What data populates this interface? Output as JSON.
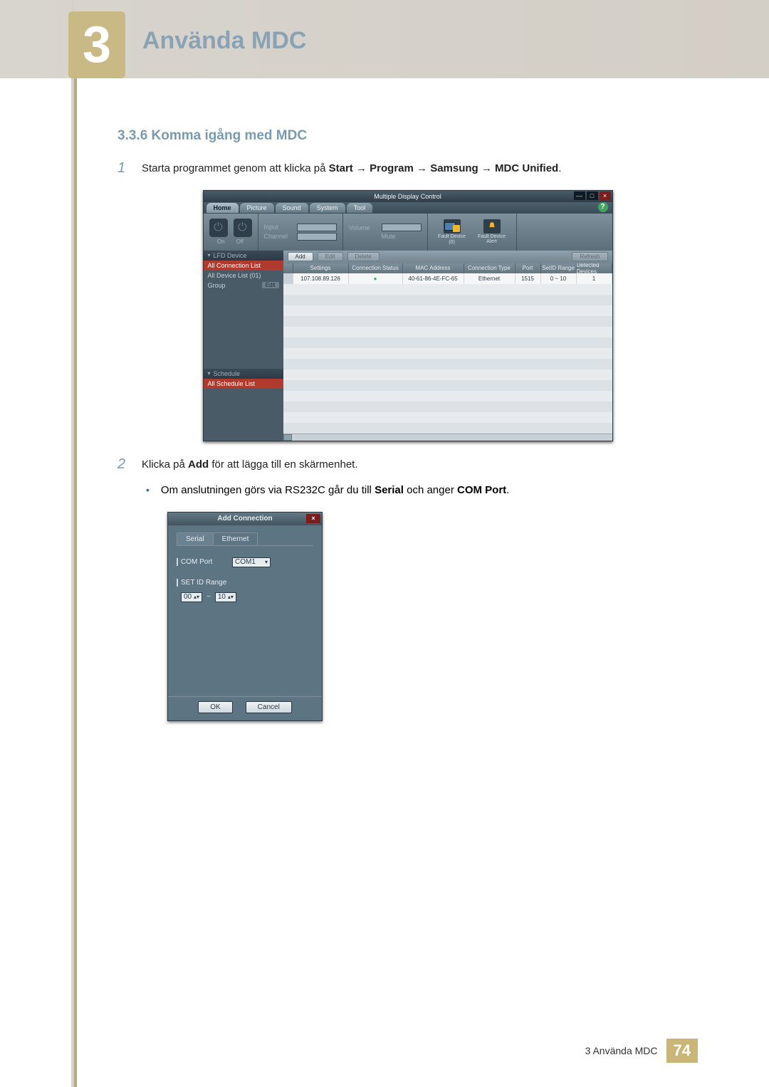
{
  "chapter": {
    "num": "3",
    "title": "Använda MDC"
  },
  "section": {
    "num": "3.3.6",
    "title": "Komma igång med MDC"
  },
  "step1": {
    "num": "1",
    "pre": "Starta programmet genom att klicka på ",
    "bold1": "Start",
    "mid1": " → ",
    "bold2": "Program",
    "mid2": " → ",
    "bold3": "Samsung",
    "mid3": " → ",
    "bold4": "MDC Unified",
    "post": "."
  },
  "mdc": {
    "title": "Multiple Display Control",
    "menus": {
      "home": "Home",
      "picture": "Picture",
      "sound": "Sound",
      "system": "System",
      "tool": "Tool"
    },
    "toolbar": {
      "on": "On",
      "off": "Off",
      "input": "Input",
      "channel": "Channel",
      "volume": "Volume",
      "mute": "Mute",
      "fault_device": "Fault Device",
      "fault_count": "(0)",
      "fault_alert": "Fault Device\nAlert"
    },
    "side": {
      "lfd": "LFD Device",
      "all_conn": "All Connection List",
      "all_device": "All Device List (01)",
      "group": "Group",
      "edit": "Edit",
      "schedule": "Schedule",
      "all_schedule": "All Schedule List"
    },
    "buttons": {
      "add": "Add",
      "edit": "Edit",
      "delete": "Delete",
      "refresh": "Refresh"
    },
    "headers": {
      "settings": "Settings",
      "conn": "Connection Status",
      "mac": "MAC Address",
      "ctype": "Connection Type",
      "port": "Port",
      "range": "SetID Range",
      "detected": "Detected Devices"
    },
    "row": {
      "settings": "107.108.89.126",
      "conn_dot": "●",
      "mac": "40-61-86-4E-FC-65",
      "ctype": "Ethernet",
      "port": "1515",
      "range": "0 ~ 10",
      "detected": "1"
    }
  },
  "step2": {
    "num": "2",
    "pre": "Klicka på ",
    "bold1": "Add",
    "post": " för att lägga till en skärmenhet."
  },
  "bullet1": {
    "pre": "Om anslutningen görs via RS232C går du till ",
    "bold1": "Serial",
    "mid": " och anger ",
    "bold2": "COM Port",
    "post": "."
  },
  "dlg": {
    "title": "Add Connection",
    "tab_serial": "Serial",
    "tab_ethernet": "Ethernet",
    "com_label": "COM Port",
    "com_value": "COM1",
    "range_label": "SET ID Range",
    "range_from": "00",
    "range_to": "10",
    "ok": "OK",
    "cancel": "Cancel"
  },
  "footer": {
    "text": "3 Använda MDC",
    "page": "74"
  }
}
